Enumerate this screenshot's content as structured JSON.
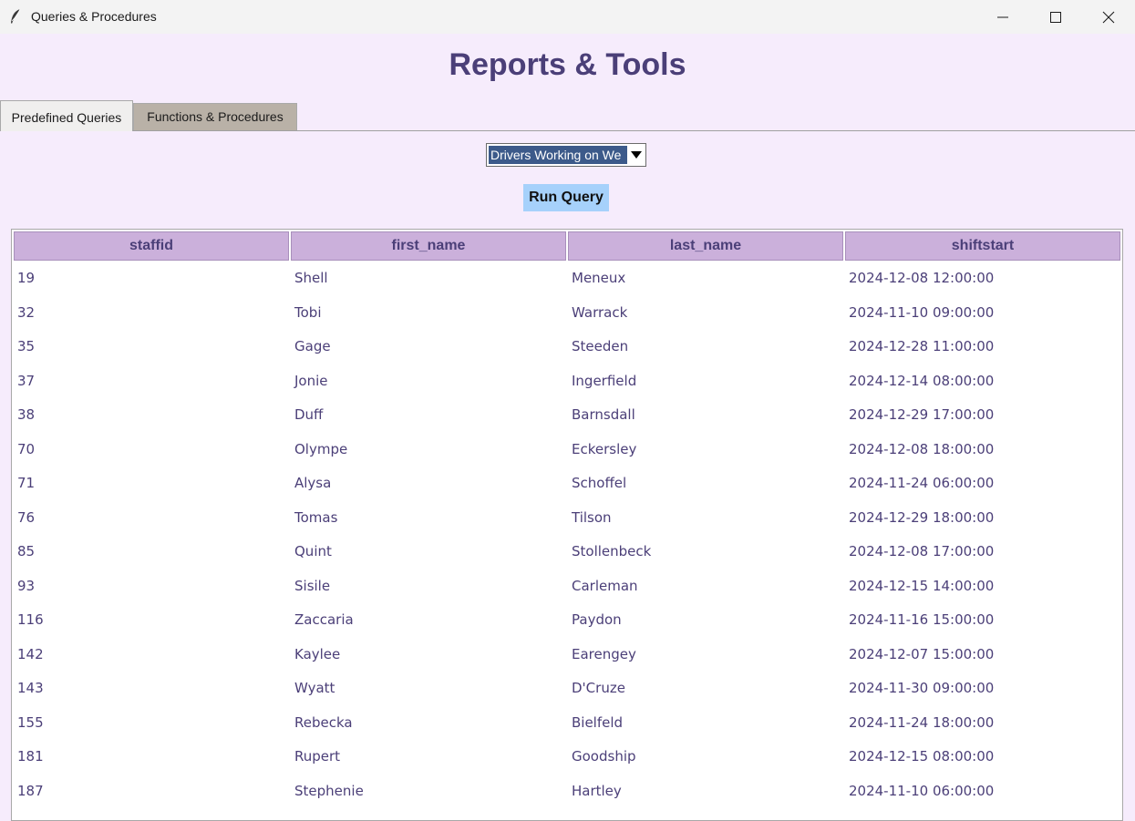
{
  "window": {
    "title": "Queries & Procedures",
    "minimize_icon": "minimize-icon",
    "maximize_icon": "maximize-icon",
    "close_icon": "close-icon",
    "app_icon": "feather-icon"
  },
  "header": {
    "title": "Reports & Tools"
  },
  "tabs": [
    {
      "label": "Predefined Queries",
      "active": true
    },
    {
      "label": "Functions & Procedures",
      "active": false
    }
  ],
  "query_select": {
    "selected": "Drivers Working on We",
    "arrow_icon": "dropdown-arrow-icon"
  },
  "run_button": {
    "label": "Run Query"
  },
  "colors": {
    "background": "#f6ecfc",
    "header_text": "#4b3f78",
    "column_header_bg": "#cbb0db",
    "run_button_bg": "#a6d1fb",
    "selected_bg": "#3c5a8a"
  },
  "table": {
    "columns": [
      "staffid",
      "first_name",
      "last_name",
      "shiftstart"
    ],
    "rows": [
      [
        "19",
        "Shell",
        "Meneux",
        "2024-12-08 12:00:00"
      ],
      [
        "32",
        "Tobi",
        "Warrack",
        "2024-11-10 09:00:00"
      ],
      [
        "35",
        "Gage",
        "Steeden",
        "2024-12-28 11:00:00"
      ],
      [
        "37",
        "Jonie",
        "Ingerfield",
        "2024-12-14 08:00:00"
      ],
      [
        "38",
        "Duff",
        "Barnsdall",
        "2024-12-29 17:00:00"
      ],
      [
        "70",
        "Olympe",
        "Eckersley",
        "2024-12-08 18:00:00"
      ],
      [
        "71",
        "Alysa",
        "Schoffel",
        "2024-11-24 06:00:00"
      ],
      [
        "76",
        "Tomas",
        "Tilson",
        "2024-12-29 18:00:00"
      ],
      [
        "85",
        "Quint",
        "Stollenbeck",
        "2024-12-08 17:00:00"
      ],
      [
        "93",
        "Sisile",
        "Carleman",
        "2024-12-15 14:00:00"
      ],
      [
        "116",
        "Zaccaria",
        "Paydon",
        "2024-11-16 15:00:00"
      ],
      [
        "142",
        "Kaylee",
        "Earengey",
        "2024-12-07 15:00:00"
      ],
      [
        "143",
        "Wyatt",
        "D'Cruze",
        "2024-11-30 09:00:00"
      ],
      [
        "155",
        "Rebecka",
        "Bielfeld",
        "2024-11-24 18:00:00"
      ],
      [
        "181",
        "Rupert",
        "Goodship",
        "2024-12-15 08:00:00"
      ],
      [
        "187",
        "Stephenie",
        "Hartley",
        "2024-11-10 06:00:00"
      ]
    ]
  }
}
